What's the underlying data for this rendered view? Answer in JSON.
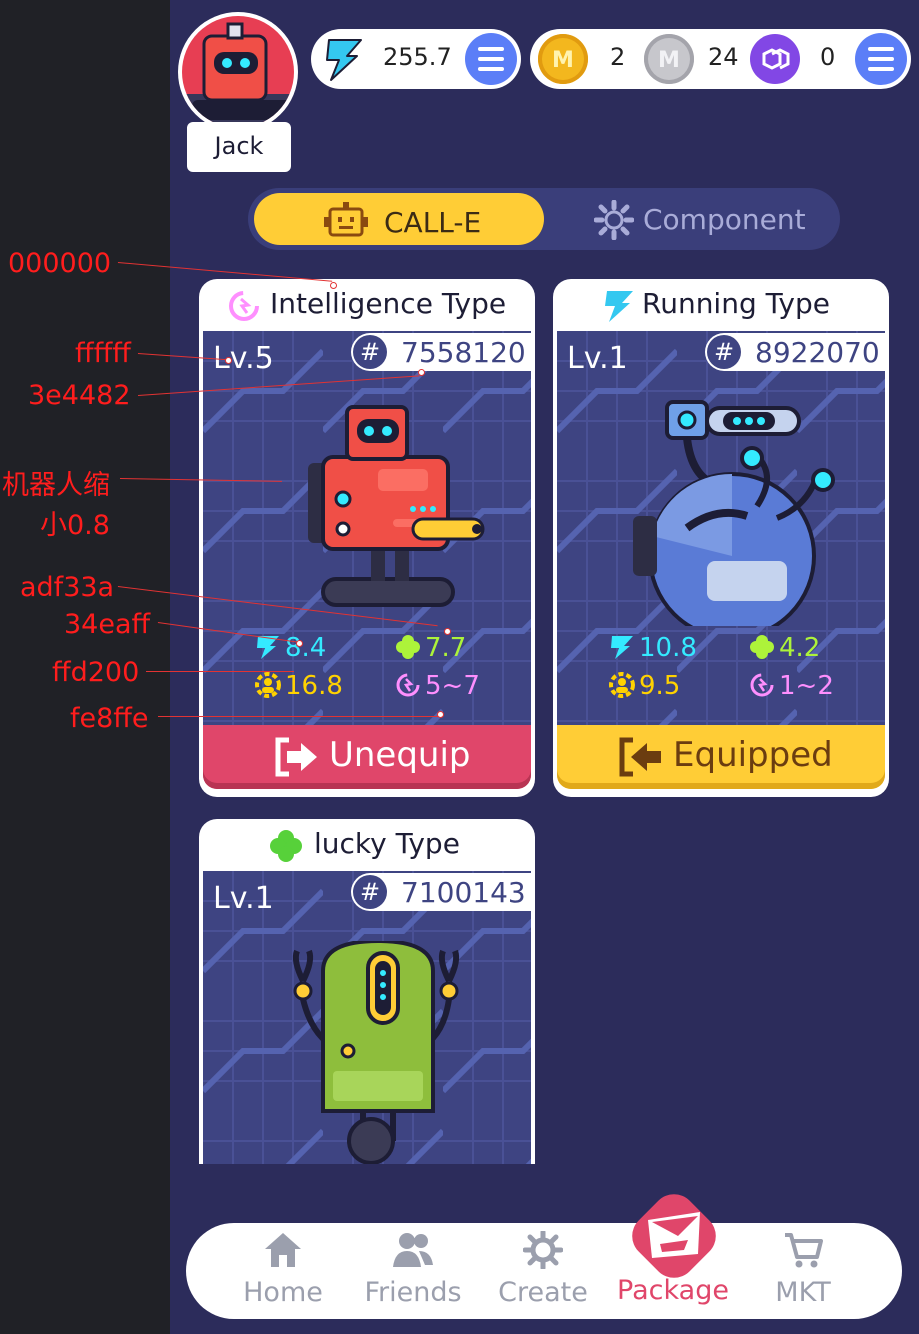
{
  "user": {
    "name": "Jack"
  },
  "wallet": {
    "energy": "255.7",
    "coins": [
      {
        "name": "gold-coin",
        "amount": "2",
        "color": "#f3b71e"
      },
      {
        "name": "silver-coin",
        "amount": "24",
        "color": "#c7c7cc"
      },
      {
        "name": "polygon-token",
        "amount": "0",
        "color": "#8247e5"
      }
    ]
  },
  "tabs": [
    {
      "label": "CALL-E",
      "active": true
    },
    {
      "label": "Component",
      "active": false
    }
  ],
  "cards": [
    {
      "type": "Intelligence Type",
      "level": "Lv.5",
      "id": "7558120",
      "stats": {
        "energy": "8.4",
        "luck": "7.7",
        "power": "16.8",
        "intelligence": "5~7"
      },
      "button": "Unequip",
      "button_color": "#e0466a"
    },
    {
      "type": "Running Type",
      "level": "Lv.1",
      "id": "8922070",
      "stats": {
        "energy": "10.8",
        "luck": "4.2",
        "power": "9.5",
        "intelligence": "1~2"
      },
      "button": "Equipped",
      "button_color": "#ffcd36"
    },
    {
      "type": "lucky Type",
      "level": "Lv.1",
      "id": "7100143"
    }
  ],
  "annotations": [
    "000000",
    "ffffff",
    "3e4482",
    "机器人缩",
    "小0.8",
    "adf33a",
    "34eaff",
    "ffd200",
    "fe8ffe"
  ],
  "colors": {
    "card_bg": "#3e4482",
    "text_white": "#ffffff",
    "luck_green": "#adf33a",
    "energy_cyan": "#34eaff",
    "power_yellow": "#ffd200",
    "intel_pink": "#fe8ffe"
  },
  "nav": [
    {
      "label": "Home",
      "icon": "home-icon",
      "active": false
    },
    {
      "label": "Friends",
      "icon": "friends-icon",
      "active": false
    },
    {
      "label": "Create",
      "icon": "gears-icon",
      "active": false
    },
    {
      "label": "Package",
      "icon": "package-icon",
      "active": true
    },
    {
      "label": "MKT",
      "icon": "cart-icon",
      "active": false
    }
  ]
}
